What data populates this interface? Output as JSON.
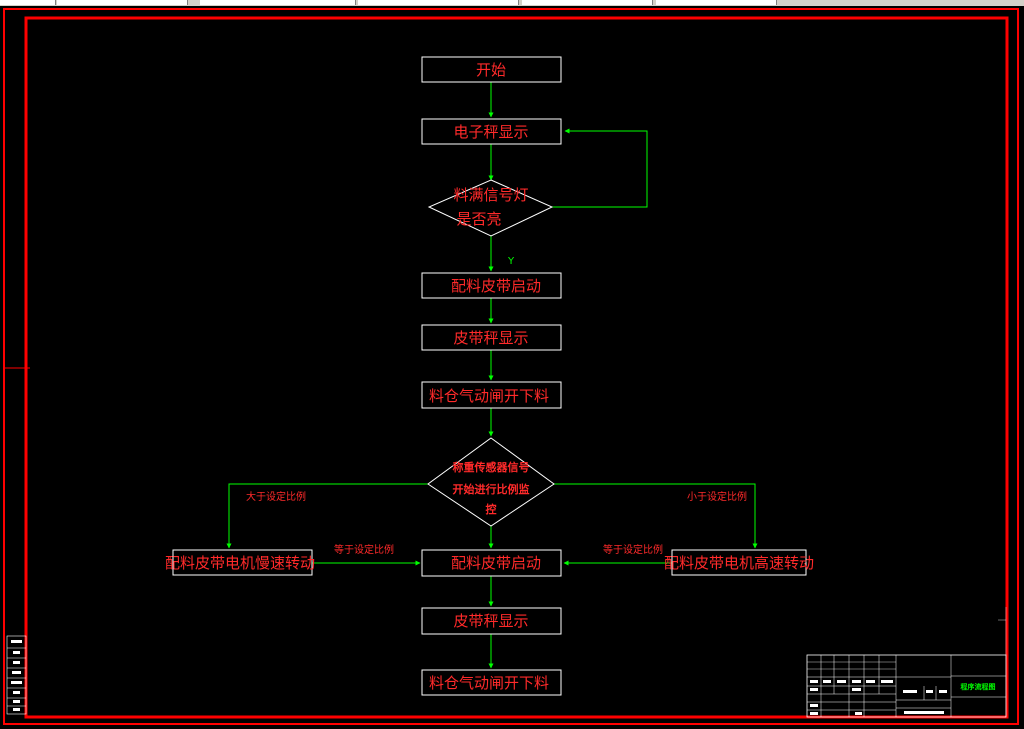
{
  "nodes": {
    "start": "开始",
    "scale_display_1": "电子秤显示",
    "full_signal_q_line1": "料满信号灯",
    "full_signal_q_line2": "是否亮",
    "belt_start_1": "配料皮带启动",
    "belt_scale_display_1": "皮带秤显示",
    "bin_gate_open_1": "料仓气动闸开下料",
    "sensor_q_line1": "称重传感器信号",
    "sensor_q_line2": "开始进行比例监",
    "sensor_q_line3": "控",
    "slow_motor": "配料皮带电机慢速转动",
    "belt_start_2": "配料皮带启动",
    "fast_motor": "配料皮带电机高速转动",
    "belt_scale_display_2": "皮带秤显示",
    "bin_gate_open_2": "料仓气动闸开下料"
  },
  "edge_labels": {
    "yes": "Y",
    "greater": "大于设定比例",
    "less": "小于设定比例",
    "equal_left": "等于设定比例",
    "equal_right": "等于设定比例"
  },
  "title_block": {
    "drawing_name": "程序流程图"
  },
  "colors": {
    "frame": "#ff0000",
    "box": "#ffffff",
    "text": "#ff2a2a",
    "connector": "#00ff00"
  }
}
